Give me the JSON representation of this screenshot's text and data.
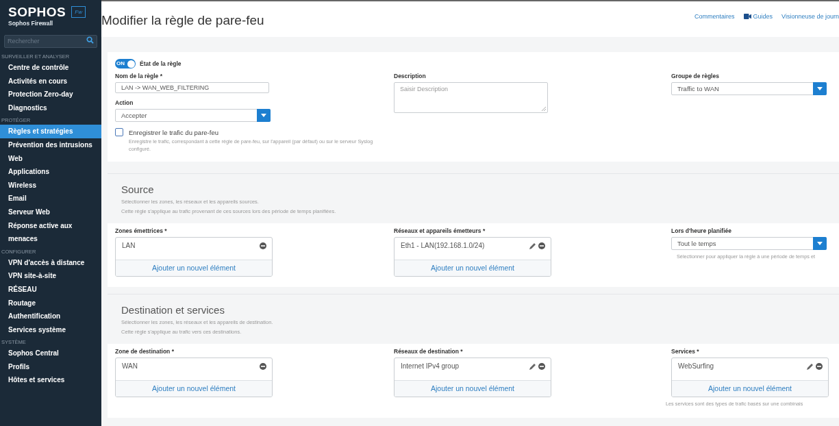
{
  "sidebar": {
    "brand": "SOPHOS",
    "badge": "Fw",
    "product": "Sophos Firewall",
    "search": {
      "placeholder": "Rechercher"
    },
    "groups": [
      {
        "heading": "SURVEILLER ET ANALYSER",
        "items": [
          {
            "label": "Centre de contrôle",
            "selected": false
          },
          {
            "label": "Activités en cours",
            "selected": false
          },
          {
            "label": "Protection Zero-day",
            "selected": false
          },
          {
            "label": "Diagnostics",
            "selected": false
          }
        ]
      },
      {
        "heading": "PROTÉGER",
        "items": [
          {
            "label": "Règles et stratégies",
            "selected": true
          },
          {
            "label": "Prévention des intrusions",
            "selected": false
          },
          {
            "label": "Web",
            "selected": false
          },
          {
            "label": "Applications",
            "selected": false
          },
          {
            "label": "Wireless",
            "selected": false
          },
          {
            "label": "Email",
            "selected": false
          },
          {
            "label": "Serveur Web",
            "selected": false
          },
          {
            "label": "Réponse active aux menaces",
            "selected": false
          }
        ]
      },
      {
        "heading": "CONFIGURER",
        "items": [
          {
            "label": "VPN d'accès à distance",
            "selected": false
          },
          {
            "label": "VPN site-à-site",
            "selected": false
          },
          {
            "label": "RÉSEAU",
            "selected": false
          },
          {
            "label": "Routage",
            "selected": false
          },
          {
            "label": "Authentification",
            "selected": false
          },
          {
            "label": "Services système",
            "selected": false
          }
        ]
      },
      {
        "heading": "SYSTÈME",
        "items": [
          {
            "label": "Sophos Central",
            "selected": false
          },
          {
            "label": "Profils",
            "selected": false
          },
          {
            "label": "Hôtes et services",
            "selected": false
          }
        ]
      }
    ]
  },
  "header": {
    "title": "Modifier la règle de pare-feu",
    "links": [
      {
        "label": "Commentaires",
        "kind": "text"
      },
      {
        "label": "Guides",
        "kind": "video"
      },
      {
        "label": "Visionneuse de journ",
        "kind": "text"
      }
    ]
  },
  "general": {
    "toggle": {
      "on": true,
      "text": "ON",
      "label": "État de la règle"
    },
    "columns": [
      [
        {
          "kind": "text",
          "label": "Nom de la règle *",
          "value": "LAN -> WAN_WEB_FILTERING"
        },
        {
          "kind": "select",
          "label": "Action",
          "value": "Accepter"
        },
        {
          "kind": "checkbox",
          "label": "Enregistrer le trafic du pare-feu",
          "checked": false,
          "hint": "Enregistre le trafic, correspondant à cette règle de pare-feu, sur l'appareil (par défaut) ou sur le serveur Syslog configuré."
        }
      ],
      [
        {
          "kind": "textarea",
          "label": "Description",
          "placeholder": "Saisir Description"
        }
      ],
      [
        {
          "kind": "select",
          "label": "Groupe de règles",
          "value": "Traffic to WAN"
        }
      ]
    ]
  },
  "sections": [
    {
      "title": "Source",
      "description": [
        "Sélectionner les zones, les réseaux et les appareils sources.",
        "Cette règle s'applique au trafic provenant de ces sources lors des période de temps planifiées."
      ],
      "columns": [
        [
          {
            "kind": "multi",
            "label": "Zones émettrices *",
            "items": [
              {
                "label": "LAN",
                "editable": false
              }
            ],
            "add_label": "Ajouter un nouvel élément"
          }
        ],
        [
          {
            "kind": "multi",
            "label": "Réseaux et appareils émetteurs *",
            "items": [
              {
                "label": "Eth1 - LAN(192.168.1.0/24)",
                "editable": true
              }
            ],
            "add_label": "Ajouter un nouvel élément"
          }
        ],
        [
          {
            "kind": "select",
            "label": "Lors d'heure planifiée",
            "value": "Tout le temps",
            "hint": "Sélectionner pour appliquer la règle à une période de temps et"
          }
        ]
      ]
    },
    {
      "title": "Destination et services",
      "description": [
        "Sélectionner les zones, les réseaux et les appareils de destination.",
        "Cette règle s'applique au trafic vers ces destinations."
      ],
      "columns": [
        [
          {
            "kind": "multi",
            "label": "Zone de destination *",
            "items": [
              {
                "label": "WAN",
                "editable": false
              }
            ],
            "add_label": "Ajouter un nouvel élément"
          }
        ],
        [
          {
            "kind": "multi",
            "label": "Réseaux de destination *",
            "items": [
              {
                "label": "Internet IPv4 group",
                "editable": true
              }
            ],
            "add_label": "Ajouter un nouvel élément"
          }
        ],
        [
          {
            "kind": "multi",
            "label": "Services *",
            "items": [
              {
                "label": "WebSurfing",
                "editable": true
              }
            ],
            "add_label": "Ajouter un nouvel élément",
            "hint": "Les services sont des types de trafic basés sur une combinais"
          }
        ]
      ]
    }
  ]
}
